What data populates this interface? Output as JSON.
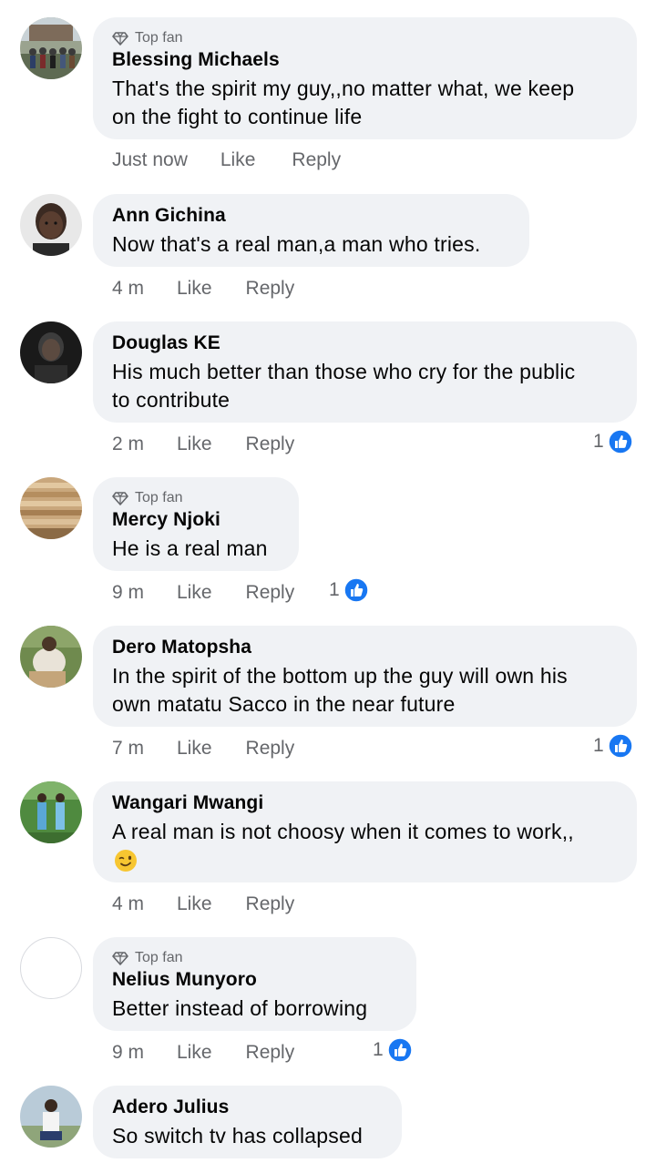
{
  "colors": {
    "bubble": "#f0f2f5",
    "secondary_text": "#65676b",
    "like_blue": "#1877f2"
  },
  "comments": [
    {
      "badge": "Top fan",
      "name": "Blessing Michaels",
      "text_lines": [
        "That's the spirit my guy,,no matter what, we keep",
        "on the fight to continue life"
      ],
      "time": "Just now",
      "like": "Like",
      "reply": "Reply"
    },
    {
      "name": "Ann Gichina",
      "text_lines": [
        "Now that's a real man,a man who tries."
      ],
      "time": "4 m",
      "like": "Like",
      "reply": "Reply"
    },
    {
      "name": "Douglas KE",
      "text_lines": [
        "His much better than those who cry for the public",
        "to contribute"
      ],
      "time": "2 m",
      "like": "Like",
      "reply": "Reply",
      "reactions": "1"
    },
    {
      "badge": "Top fan",
      "name": "Mercy Njoki",
      "text_lines": [
        "He is a real man"
      ],
      "time": "9 m",
      "like": "Like",
      "reply": "Reply",
      "reactions": "1"
    },
    {
      "name": "Dero Matopsha",
      "text_lines": [
        "In the spirit of the bottom up the guy will own his",
        "own matatu Sacco in the near future"
      ],
      "time": "7 m",
      "like": "Like",
      "reply": "Reply",
      "reactions": "1"
    },
    {
      "name": "Wangari Mwangi",
      "text_lines": [
        "A real man is not choosy when it comes to work,,"
      ],
      "emoji": "winking-face",
      "time": "4 m",
      "like": "Like",
      "reply": "Reply"
    },
    {
      "badge": "Top fan",
      "name": "Nelius Munyoro",
      "text_lines": [
        "Better instead of borrowing"
      ],
      "time": "9 m",
      "like": "Like",
      "reply": "Reply",
      "reactions": "1"
    },
    {
      "name": "Adero Julius",
      "text_lines": [
        "So switch tv has collapsed"
      ]
    }
  ]
}
